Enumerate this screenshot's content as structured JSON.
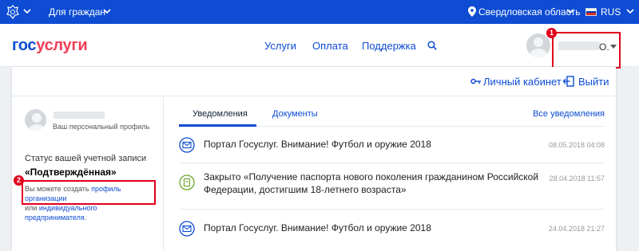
{
  "topbar": {
    "audience": "Для граждан",
    "region": "Свердловская область",
    "language": "RUS"
  },
  "header": {
    "logo_part1": "гос",
    "logo_part2": "услуги",
    "nav": [
      "Услуги",
      "Оплата",
      "Поддержка"
    ],
    "user_initial": "О.",
    "badge1": "1"
  },
  "panel": {
    "cabinet_link": "Личный кабинет",
    "exit_link": "Выйти"
  },
  "profile": {
    "profile_label": "Ваш персональный профиль",
    "status_label": "Статус вашей учетной записи",
    "status_value": "«Подтверждённая»",
    "badge2": "2",
    "note_prefix": "Вы можете создать ",
    "note_link1": "профиль организации",
    "note_middle": " или ",
    "note_link2": "индивидуального предпринимателя",
    "note_suffix": "."
  },
  "tabs": {
    "active": "Уведомления",
    "docs": "Документы",
    "all": "Все уведомления"
  },
  "notifications": [
    {
      "title": "Портал Госуслуг. Внимание! Футбол и оружие 2018",
      "date": "08.05.2018 04:08",
      "icon": "mail-icon"
    },
    {
      "title_line1": "Закрыто «Получение паспорта нового поколения гражданином Российской",
      "title_line2": "Федерации, достигшим 18-летнего возраста»",
      "date": "28.04.2018 11:57",
      "icon": "passport-icon"
    },
    {
      "title": "Портал Госуслуг. Внимание! Футбол и оружие 2018",
      "date": "24.04.2018 21:27",
      "icon": "mail-icon"
    }
  ],
  "colors": {
    "brand_blue": "#0d4cd3",
    "brand_red": "#ee3f58",
    "highlight_red": "#e0001b",
    "success_green": "#6fa52a"
  }
}
